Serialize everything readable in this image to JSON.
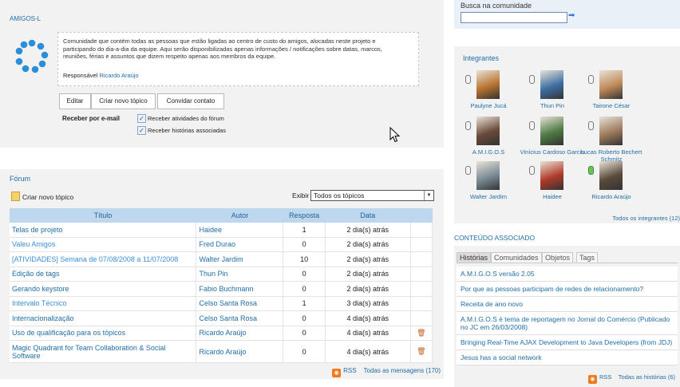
{
  "community": {
    "title": "AMIGOS-L",
    "description": "Comunidade que contém todas as pessoas que estão ligadas ao centro de custo do amigos, alocadas neste projeto e participando do dia-a-dia da equipe. Aqui serão disponibilizadas apenas informações / notificações sobre datas, marcos, reuniões, férias e assuntos que dizem respeito apenas aos membros da equipe.",
    "responsible_label": "Responsável",
    "responsible_name": "Ricardo Araújo",
    "buttons": {
      "edit": "Editar",
      "new_topic": "Criar novo tópico",
      "invite": "Convidar contato"
    },
    "email_label": "Receber por e-mail",
    "email_options": [
      {
        "label": "Receber atividades do fórum",
        "checked": true
      },
      {
        "label": "Receber histórias associadas",
        "checked": true
      }
    ]
  },
  "forum": {
    "title": "Fórum",
    "new_topic_label": "Criar novo tópico",
    "filter_label": "Exibir",
    "filter_value": "Todos os tópicos",
    "columns": [
      "Título",
      "Autor",
      "Resposta",
      "Data"
    ],
    "rows": [
      {
        "title": "Telas de projeto",
        "author": "Haidee",
        "replies": "1",
        "date": "2 dia(s) atrás",
        "trash": false,
        "color": "#1f6ea8"
      },
      {
        "title": "Valeu Amigos",
        "author": "Fred Durao",
        "replies": "0",
        "date": "2 dia(s) atrás",
        "trash": false,
        "color": "#3b8fd4"
      },
      {
        "title": "[ATIVIDADES] Semana de 07/08/2008 a 11/07/2008",
        "author": "Walter Jardim",
        "replies": "10",
        "date": "2 dia(s) atrás",
        "trash": false,
        "color": "#3b8fd4"
      },
      {
        "title": "Edição de tags",
        "author": "Thun Pin",
        "replies": "0",
        "date": "2 dia(s) atrás",
        "trash": false,
        "color": "#1f6ea8"
      },
      {
        "title": "Gerando keystore",
        "author": "Fabio Buchmann",
        "replies": "0",
        "date": "2 dia(s) atrás",
        "trash": false,
        "color": "#1f6ea8"
      },
      {
        "title": "Intervalo Técnico",
        "author": "Celso Santa Rosa",
        "replies": "1",
        "date": "3 dia(s) atrás",
        "trash": false,
        "color": "#3b8fd4"
      },
      {
        "title": "Internacionalização",
        "author": "Celso Santa Rosa",
        "replies": "0",
        "date": "4 dia(s) atrás",
        "trash": false,
        "color": "#1f6ea8"
      },
      {
        "title": "Uso de qualificação para os tópicos",
        "author": "Ricardo Araújo",
        "replies": "0",
        "date": "4 dia(s) atrás",
        "trash": true,
        "color": "#1f6ea8"
      },
      {
        "title": "Magic Quadrant for Team Collaboration & Social Software",
        "author": "Ricardo Araújo",
        "replies": "0",
        "date": "4 dia(s) atrás",
        "trash": true,
        "color": "#1f6ea8"
      }
    ],
    "rss_label": "RSS",
    "all_messages": "Todas as mensagens (170)"
  },
  "search": {
    "label": "Busca na comunidade",
    "value": ""
  },
  "members": {
    "title": "Integrantes",
    "list": [
      {
        "name": "Paulyne Jucá",
        "online": false,
        "color": "#b8732e"
      },
      {
        "name": "Thun Pin",
        "online": false,
        "color": "#3d6fa3"
      },
      {
        "name": "Tairone César",
        "online": false,
        "color": "#c08a5a"
      },
      {
        "name": "A.M.I.G.O.S",
        "online": false,
        "color": "#6a4a3a"
      },
      {
        "name": "Vinícius Cardoso Garcia",
        "online": false,
        "color": "#4f7a45"
      },
      {
        "name": "Lucas Roberto Bechert Schmitz",
        "online": false,
        "color": "#9c7a5c"
      },
      {
        "name": "Walter Jardim",
        "online": false,
        "color": "#7a8a95"
      },
      {
        "name": "Haidee",
        "online": false,
        "color": "#b03a2a"
      },
      {
        "name": "Ricardo Araújo",
        "online": true,
        "color": "#5a4a3a"
      }
    ],
    "all_members": "Todos os integrantes (12)"
  },
  "associated": {
    "title": "CONTEÚDO ASSOCIADO",
    "tabs": [
      "Histórias",
      "Comunidades",
      "Objetos",
      "Tags"
    ],
    "active_tab": "Histórias",
    "stories": [
      "A.M.I.G.O.S versão 2.05",
      "Por que as pessoas participam de redes de relacionamento?",
      "Receita de ano novo",
      "A.M.I.G.O.S é tema de reportagem no Jornal do Comércio (Publicado no JC em 26/03/2008)",
      "Bringing Real-Time AJAX Development to Java Developers (from JDJ)",
      "Jesus has a social network"
    ],
    "rss_label": "RSS",
    "all_stories": "Todas as histórias (6)"
  }
}
